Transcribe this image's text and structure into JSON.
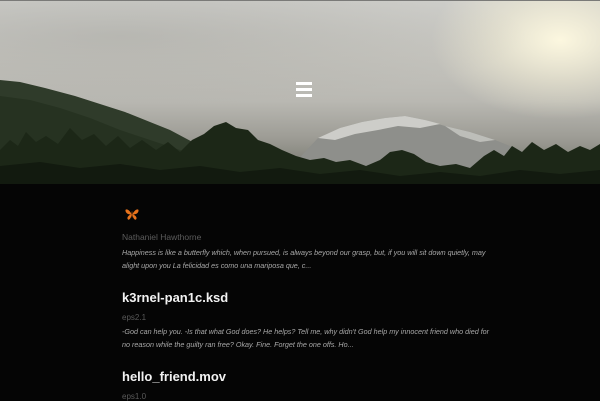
{
  "hero": {
    "menu_icon": "hamburger-menu-icon"
  },
  "blog": {
    "logo_icon": "butterfly-icon",
    "author": "Nathaniel Hawthorne",
    "quote": "Happiness is like a butterfly which, when pursued, is always beyond our grasp, but, if you will sit down quietly, may alight upon you La felicidad es como una mariposa que, c..."
  },
  "posts": [
    {
      "title": "k3rnel-pan1c.ksd",
      "meta": "eps2.1",
      "excerpt": "-God can help you. -Is that what God does? He helps? Tell me, why didn't God help my innocent friend who died for no reason while the guilty ran free? Okay. Fine. Forget the one offs. Ho..."
    },
    {
      "title": "hello_friend.mov",
      "meta": "eps1.0",
      "excerpt": ""
    }
  ],
  "colors": {
    "background": "#050505",
    "title": "#f2f2f2",
    "muted": "#5c5c5c",
    "excerpt": "#a9a9a9",
    "butterfly": "#e8731c"
  }
}
